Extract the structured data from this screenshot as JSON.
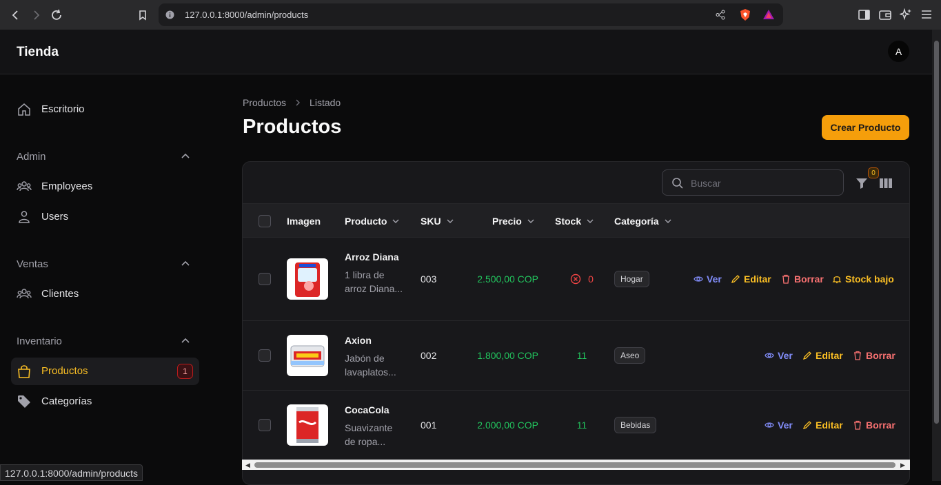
{
  "browser": {
    "url": "127.0.0.1:8000/admin/products"
  },
  "app": {
    "brand": "Tienda",
    "avatar_initial": "A"
  },
  "sidebar": {
    "top_item": "Escritorio",
    "groups": [
      {
        "label": "Admin",
        "items": [
          "Employees",
          "Users"
        ]
      },
      {
        "label": "Ventas",
        "items": [
          "Clientes"
        ]
      },
      {
        "label": "Inventario",
        "items": [
          "Productos",
          "Categorías"
        ]
      }
    ],
    "active_badge": "1"
  },
  "breadcrumb": {
    "root": "Productos",
    "current": "Listado"
  },
  "page": {
    "title": "Productos",
    "create_label": "Crear Producto"
  },
  "toolbar": {
    "search_placeholder": "Buscar",
    "filter_count": "0"
  },
  "table": {
    "headers": [
      "Imagen",
      "Producto",
      "SKU",
      "Precio",
      "Stock",
      "Categoría"
    ],
    "rows": [
      {
        "name": "Arroz Diana",
        "desc": "1 libra de arroz Diana...",
        "sku": "003",
        "price": "2.500,00 COP",
        "stock": "0",
        "category": "Hogar",
        "low_stock_label": "Stock bajo"
      },
      {
        "name": "Axion",
        "desc": "Jabón de lavaplatos...",
        "sku": "002",
        "price": "1.800,00 COP",
        "stock": "11",
        "category": "Aseo"
      },
      {
        "name": "CocaCola",
        "desc": "Suavizante de ropa...",
        "sku": "001",
        "price": "2.000,00 COP",
        "stock": "11",
        "category": "Bebidas"
      }
    ],
    "actions": {
      "view": "Ver",
      "edit": "Editar",
      "delete": "Borrar"
    }
  },
  "status_bar": "127.0.0.1:8000/admin/products",
  "colors": {
    "accent": "#f59e0b",
    "success": "#22c55e",
    "danger": "#ef4444",
    "view": "#818cf8"
  }
}
